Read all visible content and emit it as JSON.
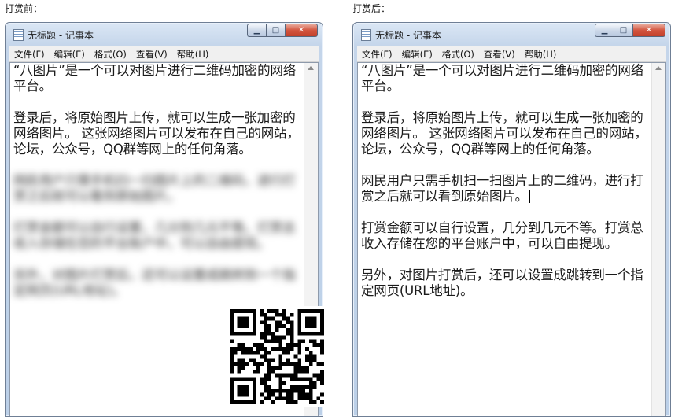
{
  "captions": {
    "before": "打赏前：",
    "after": "打赏后："
  },
  "window": {
    "title": "无标题 - 记事本",
    "controls": {
      "minimize_icon": "minimize-icon",
      "maximize_icon": "maximize-icon",
      "close_icon": "close-icon"
    },
    "menu": [
      "文件(F)",
      "编辑(E)",
      "格式(O)",
      "查看(V)",
      "帮助(H)"
    ]
  },
  "before": {
    "visible_paragraphs": [
      "“八图片”是一个可以对图片进行二维码加密的网络平台。",
      "登录后，将原始图片上传，就可以生成一张加密的网络图片。 这张网络图片可以发布在自己的网站，论坛，公众号，QQ群等网上的任何角落。"
    ],
    "blurred_paragraphs": [
      "网民用户只需手机扫一扫图片上的二维码，进行打赏之后就可以看到原始图片。",
      "打赏金额可以自行设置，几分到几元不等。打赏总收入存储在您的平台账户中，可以自由提现。",
      "另外，对图片打赏后，还可以设置成跳转到一个指定网页(URL地址)。"
    ]
  },
  "after": {
    "paragraphs": [
      "“八图片”是一个可以对图片进行二维码加密的网络平台。",
      "登录后，将原始图片上传，就可以生成一张加密的网络图片。 这张网络图片可以发布在自己的网站，论坛，公众号，QQ群等网上的任何角落。",
      "网民用户只需手机扫一扫图片上的二维码，进行打赏之后就可以看到原始图片。",
      "打赏金额可以自行设置，几分到几元不等。打赏总收入存储在您的平台账户中，可以自由提现。",
      "另外，对图片打赏后，还可以设置成跳转到一个指定网页(URL地址)。"
    ]
  },
  "colors": {
    "close_button": "#c2412a",
    "title_bar": "#c4d5ea"
  }
}
